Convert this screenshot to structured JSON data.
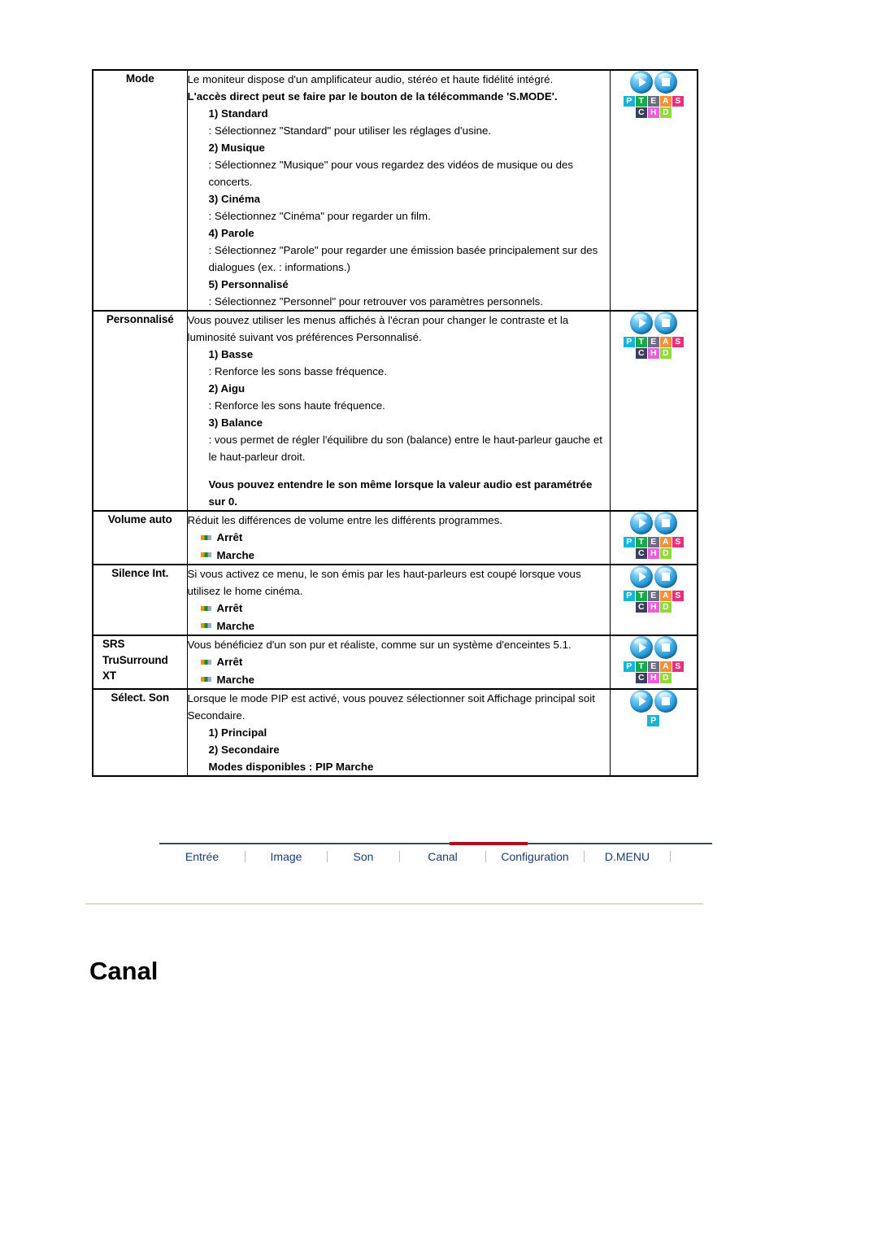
{
  "document": {
    "heading": "Canal"
  },
  "table": {
    "rows": [
      {
        "label": "Mode",
        "icon": "pteas-chd-icon",
        "blocks": [
          {
            "style": "plain",
            "text": "Le moniteur dispose d'un amplificateur audio, stéréo et haute fidélité intégré."
          },
          {
            "style": "bold",
            "text": "L'accès direct peut se faire par le bouton de la télécommande 'S.MODE'."
          },
          {
            "style": "ind1",
            "text": "1) Standard"
          },
          {
            "style": "ind2",
            "text": ": Sélectionnez \"Standard\" pour utiliser les réglages d'usine."
          },
          {
            "style": "ind1",
            "text": "2) Musique"
          },
          {
            "style": "ind2",
            "text": ": Sélectionnez \"Musique\" pour vous regardez des vidéos de musique ou des concerts."
          },
          {
            "style": "ind1",
            "text": "3) Cinéma"
          },
          {
            "style": "ind2",
            "text": ": Sélectionnez \"Cinéma\" pour regarder un film."
          },
          {
            "style": "ind1",
            "text": "4) Parole"
          },
          {
            "style": "ind2",
            "text": ": Sélectionnez \"Parole\" pour regarder une émission basée principalement sur des dialogues (ex. : informations.)"
          },
          {
            "style": "ind1",
            "text": "5) Personnalisé"
          },
          {
            "style": "ind2",
            "text": ": Sélectionnez \"Personnel\" pour retrouver vos paramètres personnels."
          }
        ]
      },
      {
        "label": "Personnalisé",
        "icon": "pteas-chd-icon",
        "blocks": [
          {
            "style": "plain",
            "text": "Vous pouvez utiliser les menus affichés à l'écran pour changer le contraste et la luminosité suivant vos préférences Personnalisé."
          },
          {
            "style": "ind1",
            "text": "1) Basse"
          },
          {
            "style": "ind2",
            "text": ": Renforce les sons basse fréquence."
          },
          {
            "style": "ind1",
            "text": "2) Aigu"
          },
          {
            "style": "ind2",
            "text": ": Renforce les sons haute fréquence."
          },
          {
            "style": "ind1",
            "text": "3) Balance"
          },
          {
            "style": "ind2",
            "text": ": vous permet de régler l'équilibre du son (balance) entre le haut-parleur gauche et le haut-parleur droit."
          },
          {
            "style": "spacer",
            "text": ""
          },
          {
            "style": "boldind",
            "text": "Vous pouvez entendre le son même lorsque la valeur audio est paramétrée sur 0."
          }
        ]
      },
      {
        "label": "Volume auto",
        "icon": "pteas-chd-icon",
        "blocks": [
          {
            "style": "plain",
            "text": "Réduit les différences de volume entre les différents programmes."
          },
          {
            "style": "bullet",
            "text": "Arrêt"
          },
          {
            "style": "bullet",
            "text": "Marche"
          }
        ]
      },
      {
        "label": "Silence Int.",
        "icon": "pteas-chd-icon",
        "blocks": [
          {
            "style": "plain",
            "text": "Si vous activez ce menu, le son émis par les haut-parleurs est coupé lorsque vous utilisez le home cinéma."
          },
          {
            "style": "bullet",
            "text": "Arrêt"
          },
          {
            "style": "bullet",
            "text": "Marche"
          }
        ]
      },
      {
        "label": "SRS\nTruSurround\nXT",
        "icon": "pteas-chd-icon",
        "blocks": [
          {
            "style": "plain",
            "text": "Vous bénéficiez d'un son pur et réaliste, comme sur un système d'enceintes 5.1."
          },
          {
            "style": "bullet",
            "text": "Arrêt"
          },
          {
            "style": "bullet",
            "text": "Marche"
          }
        ]
      },
      {
        "label": "Sélect. Son",
        "icon": "p-only-icon",
        "blocks": [
          {
            "style": "plain",
            "text": "Lorsque le mode PIP est activé, vous pouvez sélectionner soit Affichage principal soit Secondaire."
          },
          {
            "style": "ind1",
            "text": "1) Principal"
          },
          {
            "style": "ind1",
            "text": "2) Secondaire"
          },
          {
            "style": "ind1",
            "text": "Modes disponibles : PIP Marche"
          }
        ]
      }
    ]
  },
  "icon_tiles": {
    "row1": [
      {
        "letter": "P",
        "color": "#1ab4d4"
      },
      {
        "letter": "T",
        "color": "#17a94c"
      },
      {
        "letter": "E",
        "color": "#6b6e82"
      },
      {
        "letter": "A",
        "color": "#f4903a"
      },
      {
        "letter": "S",
        "color": "#e5307e"
      }
    ],
    "row2": [
      {
        "letter": "C",
        "color": "#3a3f5c"
      },
      {
        "letter": "H",
        "color": "#e85fd6"
      },
      {
        "letter": "D",
        "color": "#8fd93a"
      }
    ],
    "single": {
      "letter": "P",
      "color": "#1ab4d4"
    }
  },
  "bottom_nav": {
    "items": [
      {
        "label": "Entrée",
        "active": false
      },
      {
        "label": "Image",
        "active": false
      },
      {
        "label": "Son",
        "active": false
      },
      {
        "label": "Canal",
        "active": true
      },
      {
        "label": "Configuration",
        "active": false
      },
      {
        "label": "D.MENU",
        "active": false
      }
    ],
    "accent_color": "#a81022",
    "text_color": "#1d3b6e"
  }
}
